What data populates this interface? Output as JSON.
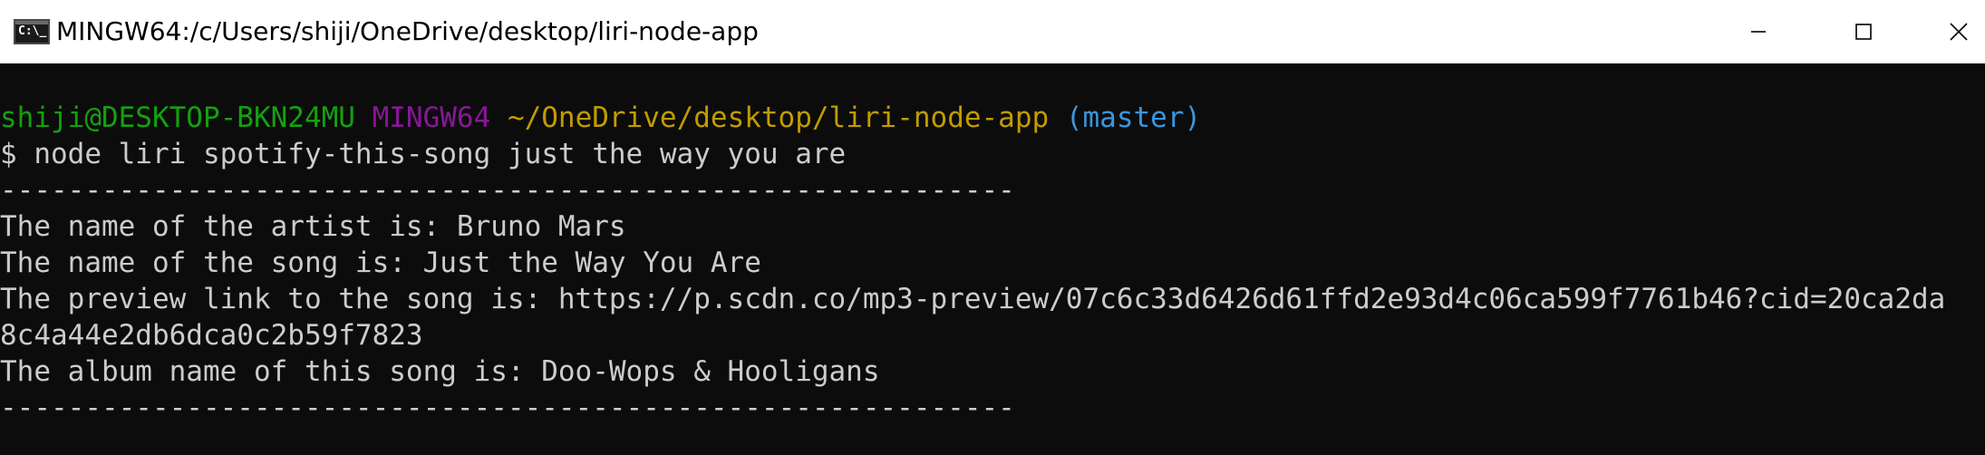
{
  "window": {
    "title": "MINGW64:/c/Users/shiji/OneDrive/desktop/liri-node-app",
    "app_icon_text": "C:\\_",
    "icons": {
      "app": "terminal-app-icon",
      "minimize": "minimize-icon",
      "maximize": "maximize-icon",
      "close": "close-icon"
    }
  },
  "colors": {
    "terminal_background": "#0c0c0c",
    "text": "#cccccc",
    "user_host": "#13a10e",
    "shell_name": "#881798",
    "path": "#c19c00",
    "git_branch": "#3a96dd"
  },
  "terminal": {
    "prompt": {
      "user_host": "shiji@DESKTOP-BKN24MU",
      "shell": "MINGW64",
      "path": "~/OneDrive/desktop/liri-node-app",
      "branch": "(master)"
    },
    "command": "$ node liri spotify-this-song just the way you are",
    "separator_top": "------------------------------------------------------------",
    "artist_line": "The name of the artist is: Bruno Mars",
    "song_line": "The name of the song is: Just the Way You Are",
    "preview_line_1": "The preview link to the song is: https://p.scdn.co/mp3-preview/07c6c33d6426d61ffd2e93d4c06ca599f7761b46?cid=20ca2da",
    "preview_line_2": "8c4a44e2db6dca0c2b59f7823",
    "album_line": "The album name of this song is: Doo-Wops & Hooligans",
    "separator_bottom": "------------------------------------------------------------"
  }
}
